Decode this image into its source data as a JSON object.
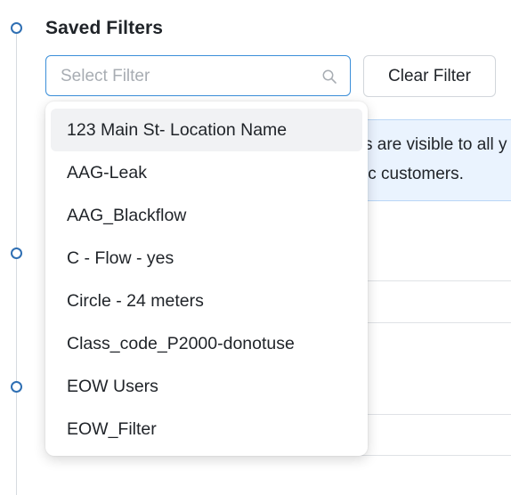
{
  "section": {
    "title": "Saved Filters"
  },
  "filter_select": {
    "placeholder": "Select Filter",
    "icon": "search-icon"
  },
  "clear_button": {
    "label": "Clear Filter"
  },
  "info_banner": {
    "line1": "s are visible to all y",
    "line2": "ic customers."
  },
  "dropdown": {
    "items": [
      {
        "label": "123 Main St- Location Name",
        "highlighted": true
      },
      {
        "label": "AAG-Leak",
        "highlighted": false
      },
      {
        "label": "AAG_Blackflow",
        "highlighted": false
      },
      {
        "label": "C - Flow - yes",
        "highlighted": false
      },
      {
        "label": "Circle - 24 meters",
        "highlighted": false
      },
      {
        "label": "Class_code_P2000-donotuse",
        "highlighted": false
      },
      {
        "label": "EOW Users",
        "highlighted": false
      },
      {
        "label": "EOW_Filter",
        "highlighted": false
      }
    ]
  },
  "colors": {
    "accent": "#3b8fd9",
    "timeline": "#2f6fb3",
    "banner_bg": "#eaf3fe",
    "highlight_bg": "#f1f2f4"
  }
}
